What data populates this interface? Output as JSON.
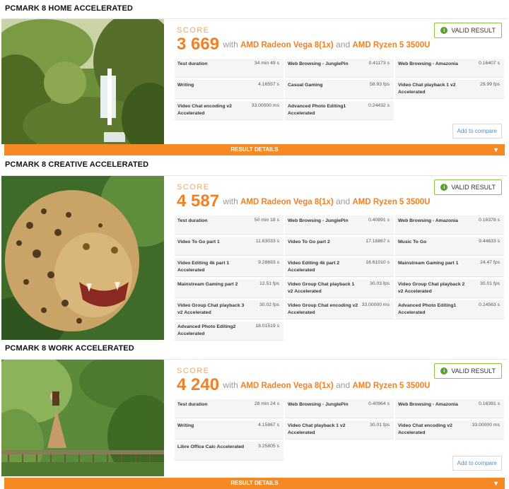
{
  "sections": [
    {
      "title": "PCMARK 8 HOME ACCELERATED",
      "score_label": "SCORE",
      "score": "3 669",
      "with": "with",
      "gpu": "AMD Radeon Vega 8(1x)",
      "and": "and",
      "cpu": "AMD Ryzen 5 3500U",
      "valid_label": "VALID RESULT",
      "compare_label": "Add to compare",
      "details_label": "RESULT DETAILS",
      "rows": [
        {
          "name": "Test duration",
          "value": "34 min 49 s"
        },
        {
          "name": "Web Browsing - JunglePin",
          "value": "0.41173 s"
        },
        {
          "name": "Web Browsing - Amazonia",
          "value": "0.16407 s"
        },
        {
          "name": "Writing",
          "value": "4.16557 s"
        },
        {
          "name": "Casual Gaming",
          "value": "58.93 fps"
        },
        {
          "name": "Video Chat playback 1 v2 Accelerated",
          "value": "29.99 fps"
        },
        {
          "name": "Video Chat encoding v2 Accelerated",
          "value": "33.00000 ms"
        },
        {
          "name": "Advanced Photo Editing1 Accelerated",
          "value": "0.24432 s"
        }
      ]
    },
    {
      "title": "PCMARK 8 CREATIVE ACCELERATED",
      "score_label": "SCORE",
      "score": "4 587",
      "with": "with",
      "gpu": "AMD Radeon Vega 8(1x)",
      "and": "and",
      "cpu": "AMD Ryzen 5 3500U",
      "valid_label": "VALID RESULT",
      "rows": [
        {
          "name": "Test duration",
          "value": "50 min 18 s"
        },
        {
          "name": "Web Browsing - JunglePin",
          "value": "0.40891 s"
        },
        {
          "name": "Web Browsing - Amazonia",
          "value": "0.16378 s"
        },
        {
          "name": "Video To Go part 1",
          "value": "11.63033 s"
        },
        {
          "name": "Video To Go part 2",
          "value": "17.18867 s"
        },
        {
          "name": "Music To Go",
          "value": "9.44633 s"
        },
        {
          "name": "Video Editing 4k part 1 Accelerated",
          "value": "9.28693 s"
        },
        {
          "name": "Video Editing 4k part 2 Accelerated",
          "value": "16.61010 s"
        },
        {
          "name": "Mainstream Gaming part 1",
          "value": "24.47 fps"
        },
        {
          "name": "Mainstream Gaming part 2",
          "value": "12.51 fps"
        },
        {
          "name": "Video Group Chat playback 1 v2 Accelerated",
          "value": "30.03 fps"
        },
        {
          "name": "Video Group Chat playback 2 v2 Accelerated",
          "value": "30.01 fps"
        },
        {
          "name": "Video Group Chat playback 3 v2 Accelerated",
          "value": "30.02 fps"
        },
        {
          "name": "Video Group Chat encoding v2 Accelerated",
          "value": "33.00000 ms"
        },
        {
          "name": "Advanced Photo Editing1 Accelerated",
          "value": "0.24563 s"
        },
        {
          "name": "Advanced Photo Editing2 Accelerated",
          "value": "18.01519 s"
        }
      ]
    },
    {
      "title": "PCMARK 8 WORK ACCELERATED",
      "score_label": "SCORE",
      "score": "4 240",
      "with": "with",
      "gpu": "AMD Radeon Vega 8(1x)",
      "and": "and",
      "cpu": "AMD Ryzen 5 3500U",
      "valid_label": "VALID RESULT",
      "compare_label": "Add to compare",
      "details_label": "RESULT DETAILS",
      "rows": [
        {
          "name": "Test duration",
          "value": "28 min 24 s"
        },
        {
          "name": "Web Browsing - JunglePin",
          "value": "0.40964 s"
        },
        {
          "name": "Web Browsing - Amazonia",
          "value": "0.16391 s"
        },
        {
          "name": "Writing",
          "value": "4.15867 s"
        },
        {
          "name": "Video Chat playback 1 v2 Accelerated",
          "value": "30.01 fps"
        },
        {
          "name": "Video Chat encoding v2 Accelerated",
          "value": "33.00000 ms"
        },
        {
          "name": "Libre Office Calc Accelerated",
          "value": "3.25805 s"
        }
      ]
    }
  ],
  "icons": {
    "valid": "check-circle-icon",
    "details": "chevron-down-icon"
  },
  "colors": {
    "accent": "#f57f21",
    "details_bar": "#f58a24",
    "valid_border": "#8dc63f",
    "link": "#4a90c8"
  }
}
